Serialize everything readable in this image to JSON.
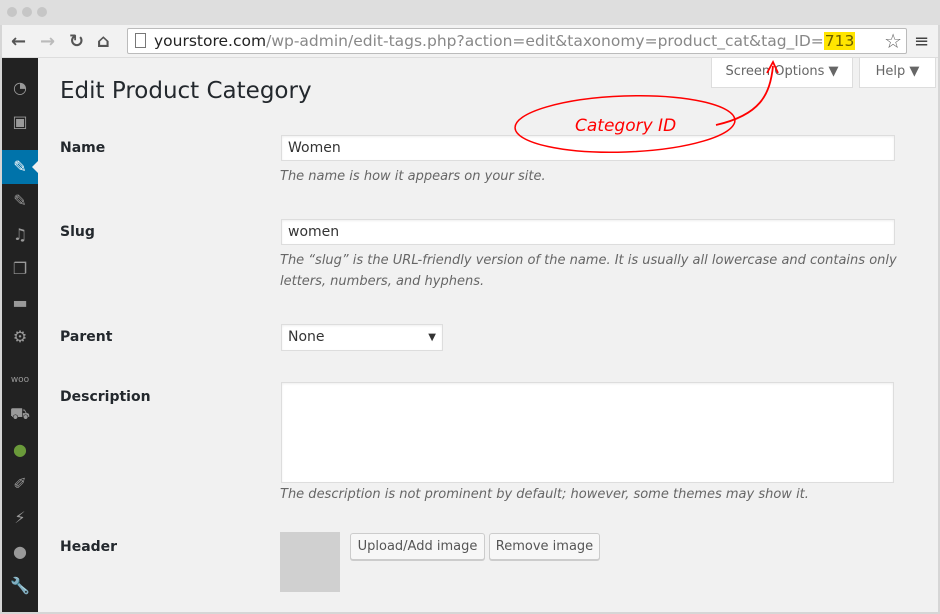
{
  "browser": {
    "url_host": "yourstore.com",
    "url_path": "/wp-admin/edit-tags.php?action=edit&taxonomy=product_cat&tag_ID=",
    "url_id": "713"
  },
  "top_buttons": {
    "screen_options": "Screen Options ▼",
    "help": "Help ▼"
  },
  "annotation": {
    "text": "Category ID",
    "color": "#ff0000"
  },
  "page": {
    "title": "Edit Product Category"
  },
  "form": {
    "name": {
      "label": "Name",
      "value": "Women",
      "help": "The name is how it appears on your site."
    },
    "slug": {
      "label": "Slug",
      "value": "women",
      "help": "The “slug” is the URL-friendly version of the name. It is usually all lowercase and contains only letters, numbers, and hyphens."
    },
    "parent": {
      "label": "Parent",
      "value": "None"
    },
    "description": {
      "label": "Description",
      "value": "",
      "help": "The description is not prominent by default; however, some themes may show it."
    },
    "header": {
      "label": "Header",
      "upload": "Upload/Add image",
      "remove": "Remove image"
    }
  },
  "sidebar": {
    "icons": [
      "dashboard",
      "updates",
      "pin-active",
      "posts",
      "media",
      "pages",
      "comments",
      "settings",
      "woocommerce",
      "cart",
      "envato",
      "appearance",
      "plugins",
      "users",
      "tools"
    ],
    "accent": "#0073aa"
  }
}
